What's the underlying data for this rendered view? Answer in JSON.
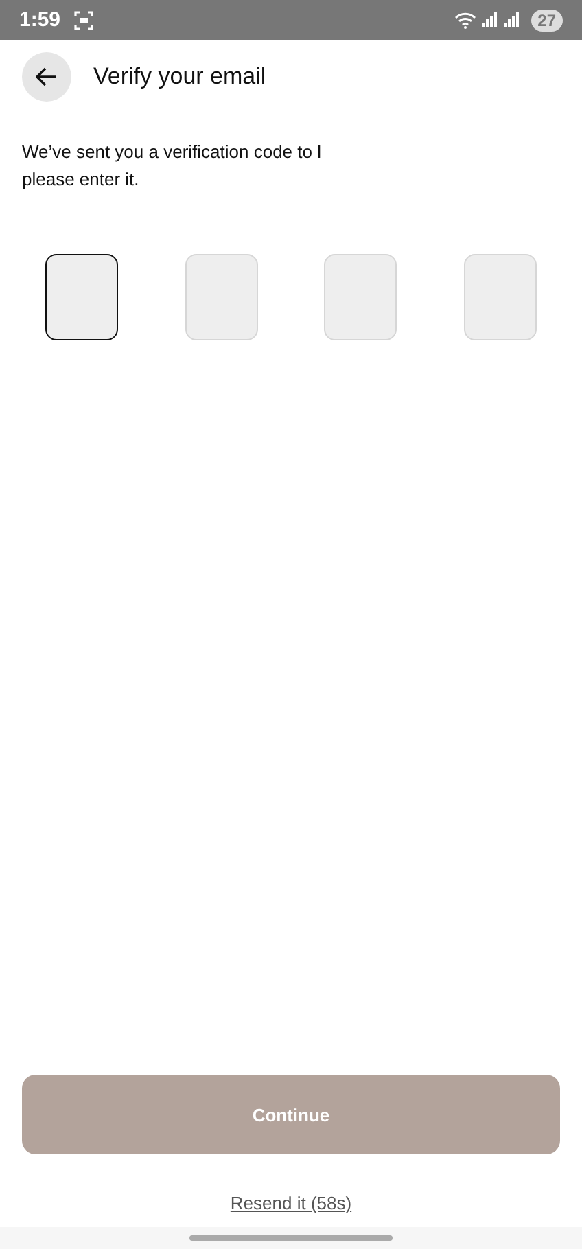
{
  "status_bar": {
    "time": "1:59",
    "battery": "27"
  },
  "header": {
    "title": "Verify your email"
  },
  "message": "We’ve sent you a verification code to l\nplease enter it.",
  "code_boxes": [
    {
      "focused": true
    },
    {
      "focused": false
    },
    {
      "focused": false
    },
    {
      "focused": false
    }
  ],
  "continue_button": {
    "label": "Continue",
    "disabled": true
  },
  "resend_link": "Resend it (58s)"
}
